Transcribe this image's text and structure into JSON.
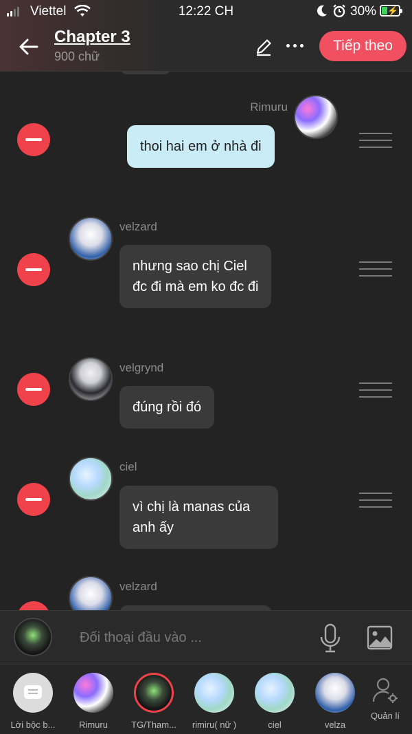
{
  "status": {
    "carrier": "Viettel",
    "time": "12:22 CH",
    "battery": "30%"
  },
  "header": {
    "title": "Chapter 3",
    "word_count": "900 chữ",
    "next_label": "Tiếp theo"
  },
  "messages": [
    {
      "name": "Rimuru",
      "text": "thoi hai em ở nhà đi",
      "side": "right",
      "avatar": "rimuru"
    },
    {
      "name": "velzard",
      "text": "nhưng sao chị Ciel\nđc đi mà em ko đc đi",
      "side": "left",
      "avatar": "velzard"
    },
    {
      "name": "velgrynd",
      "text": "đúng rồi đó",
      "side": "left",
      "avatar": "velgrynd"
    },
    {
      "name": "ciel",
      "text": "vì chị là manas của\nanh ấy",
      "side": "left",
      "avatar": "ciel"
    },
    {
      "name": "velzard",
      "text": "",
      "side": "left",
      "avatar": "velzard"
    }
  ],
  "composer": {
    "placeholder": "Đối thoại đầu vào ..."
  },
  "characters": [
    {
      "label": "Lời bộc b...",
      "avatar": "narration"
    },
    {
      "label": "Rimuru",
      "avatar": "rimuru"
    },
    {
      "label": "TG/Tham...",
      "avatar": "tg",
      "selected": true
    },
    {
      "label": "rimiru( nữ )",
      "avatar": "ciel"
    },
    {
      "label": "ciel",
      "avatar": "ciel"
    },
    {
      "label": "velza",
      "avatar": "velzard"
    }
  ],
  "manage_label": "Quản lí",
  "colors": {
    "accent": "#f05060",
    "delete": "#f0424b",
    "own_bubble": "#c9ecf7",
    "other_bubble": "#3a3a3a",
    "background": "#232323"
  },
  "icons": [
    "back-arrow-icon",
    "pencil-icon",
    "more-icon",
    "microphone-icon",
    "image-icon",
    "manage-user-icon",
    "delete-icon",
    "drag-handle-icon"
  ]
}
